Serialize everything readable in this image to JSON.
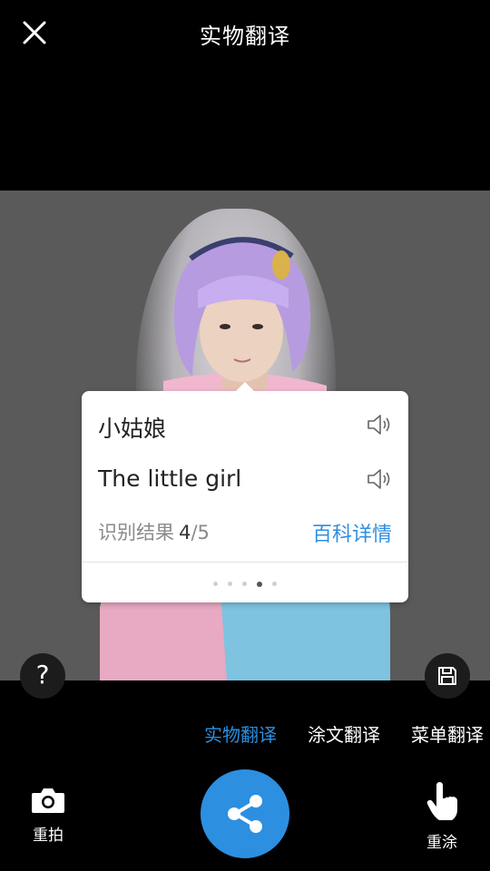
{
  "header": {
    "title": "实物翻译",
    "close_icon": "close-icon"
  },
  "popup": {
    "word_cn": "小姑娘",
    "word_en": "The little girl",
    "result_label": "识别结果",
    "result_current": "4",
    "result_total": "/5",
    "baike_link": "百科详情",
    "pager": {
      "count": 5,
      "active_index": 3
    }
  },
  "help_label": "?",
  "modes": [
    {
      "label": "实物翻译",
      "active": true
    },
    {
      "label": "涂文翻译",
      "active": false
    },
    {
      "label": "菜单翻译",
      "active": false
    }
  ],
  "bottom": {
    "retake_label": "重拍",
    "repaint_label": "重涂"
  },
  "colors": {
    "accent": "#2d8fe0",
    "background": "#000000",
    "popup_bg": "#ffffff"
  }
}
